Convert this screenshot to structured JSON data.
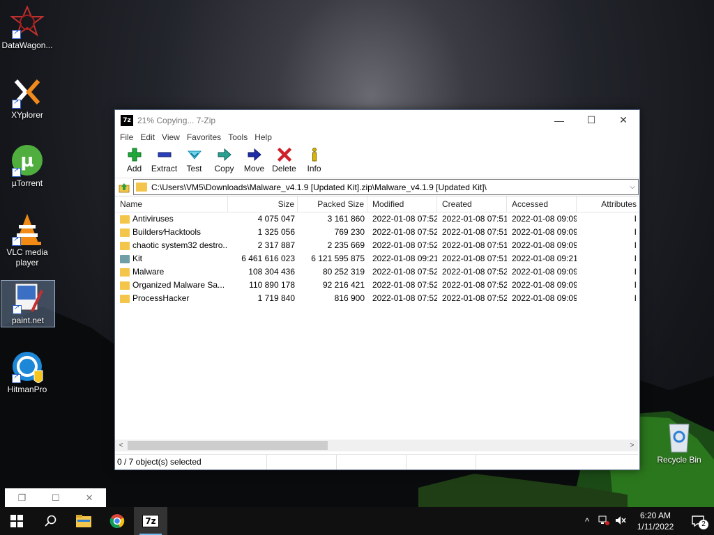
{
  "desktop": {
    "icons": [
      {
        "label": "DataWagon..."
      },
      {
        "label": "XYplorer"
      },
      {
        "label": "µTorrent"
      },
      {
        "label": "VLC media player"
      },
      {
        "label": "paint.net"
      },
      {
        "label": "HitmanPro"
      },
      {
        "label": "Recycle Bin"
      }
    ]
  },
  "window": {
    "title": "21% Copying... 7-Zip",
    "app_icon_text": "7z",
    "controls": {
      "minimize": "—",
      "maximize": "☐",
      "close": "✕"
    },
    "menu": [
      "File",
      "Edit",
      "View",
      "Favorites",
      "Tools",
      "Help"
    ],
    "toolbar": [
      {
        "label": "Add",
        "icon": "add-icon",
        "color": "#1fa83a"
      },
      {
        "label": "Extract",
        "icon": "extract-icon",
        "color": "#2a3fb8"
      },
      {
        "label": "Test",
        "icon": "test-icon",
        "color": "#2ab3d6"
      },
      {
        "label": "Copy",
        "icon": "copy-icon",
        "color": "#2aa190"
      },
      {
        "label": "Move",
        "icon": "move-icon",
        "color": "#1c2ea8"
      },
      {
        "label": "Delete",
        "icon": "delete-icon",
        "color": "#d0202a"
      },
      {
        "label": "Info",
        "icon": "info-icon",
        "color": "#d9b400"
      }
    ],
    "address": "C:\\Users\\VM5\\Downloads\\Malware_v4.1.9 [Updated Kit].zip\\Malware_v4.1.9 [Updated Kit]\\",
    "columns": [
      "Name",
      "Size",
      "Packed Size",
      "Modified",
      "Created",
      "Accessed",
      "Attributes"
    ],
    "rows": [
      {
        "name": "Antiviruses",
        "size": "4 075 047",
        "packed": "3 161 860",
        "modified": "2022-01-08 07:52",
        "created": "2022-01-08 07:51",
        "accessed": "2022-01-08 09:09",
        "attr": "I",
        "type": "folder"
      },
      {
        "name": "Builders⁄Hacktools",
        "size": "1 325 056",
        "packed": "769 230",
        "modified": "2022-01-08 07:52",
        "created": "2022-01-08 07:51",
        "accessed": "2022-01-08 09:09",
        "attr": "I",
        "type": "folder"
      },
      {
        "name": "chaotic system32 destro...",
        "size": "2 317 887",
        "packed": "2 235 669",
        "modified": "2022-01-08 07:52",
        "created": "2022-01-08 07:51",
        "accessed": "2022-01-08 09:09",
        "attr": "I",
        "type": "folder"
      },
      {
        "name": "Kit",
        "size": "6 461 616 023",
        "packed": "6 121 595 875",
        "modified": "2022-01-08 09:21",
        "created": "2022-01-08 07:51",
        "accessed": "2022-01-08 09:21",
        "attr": "I",
        "type": "kit"
      },
      {
        "name": "Malware",
        "size": "108 304 436",
        "packed": "80 252 319",
        "modified": "2022-01-08 07:52",
        "created": "2022-01-08 07:52",
        "accessed": "2022-01-08 09:09",
        "attr": "I",
        "type": "folder"
      },
      {
        "name": "Organized Malware Sa...",
        "size": "110 890 178",
        "packed": "92 216 421",
        "modified": "2022-01-08 07:52",
        "created": "2022-01-08 07:52",
        "accessed": "2022-01-08 09:09",
        "attr": "I",
        "type": "folder"
      },
      {
        "name": "ProcessHacker",
        "size": "1 719 840",
        "packed": "816 900",
        "modified": "2022-01-08 07:52",
        "created": "2022-01-08 07:52",
        "accessed": "2022-01-08 09:09",
        "attr": "I",
        "type": "folder"
      }
    ],
    "status": "0 / 7 object(s) selected"
  },
  "mini_window": {
    "restore": "❐",
    "maximize": "☐",
    "close": "✕"
  },
  "taskbar": {
    "clock_time": "6:20 AM",
    "clock_date": "1/11/2022",
    "notification_count": "2",
    "pinned": [
      "start-icon",
      "search-icon",
      "file-explorer-icon",
      "chrome-icon",
      "7zip-icon"
    ],
    "sevenzip_label": "7z"
  }
}
